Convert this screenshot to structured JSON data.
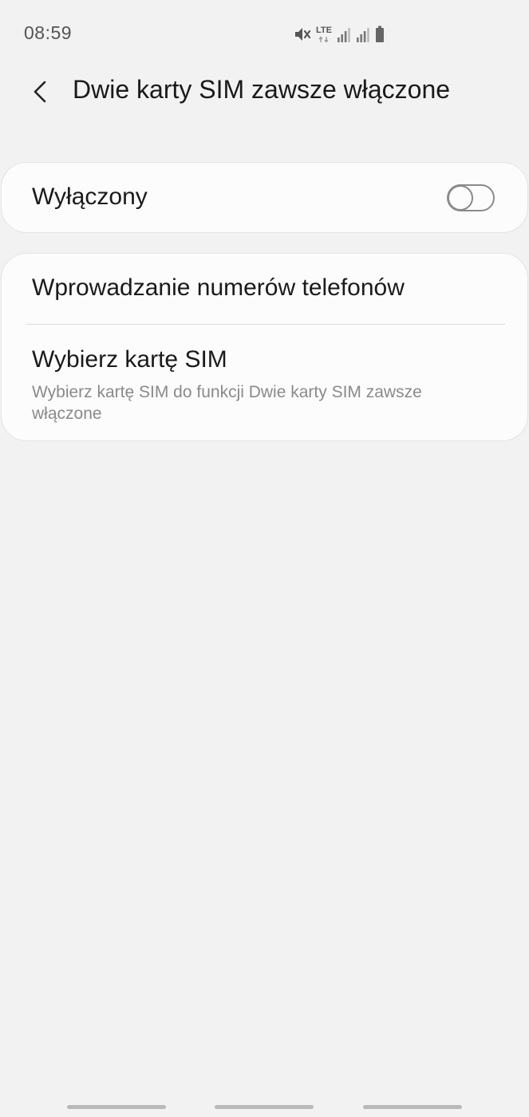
{
  "status_bar": {
    "time": "08:59",
    "network_label": "LTE",
    "icons": [
      "mute-icon",
      "lte-data-icon",
      "signal-sim1-icon",
      "signal-sim2-icon",
      "battery-icon"
    ]
  },
  "header": {
    "back_icon": "chevron-left-icon",
    "title": "Dwie karty SIM zawsze włączone"
  },
  "master_switch": {
    "label": "Wyłączony",
    "state": "off"
  },
  "menu": {
    "items": [
      {
        "title": "Wprowadzanie numerów telefonów"
      },
      {
        "title": "Wybierz kartę SIM",
        "subtitle": "Wybierz kartę SIM do funkcji Dwie karty SIM zawsze włączone"
      }
    ]
  },
  "nav_bar": {
    "handles": [
      "recent-apps-handle",
      "home-handle",
      "back-handle"
    ]
  },
  "colors": {
    "background": "#f2f2f2",
    "card": "#fcfcfc",
    "text_primary": "#1a1a1a",
    "text_secondary": "#8a8a8a",
    "switch_off": "#8a8a8a"
  }
}
